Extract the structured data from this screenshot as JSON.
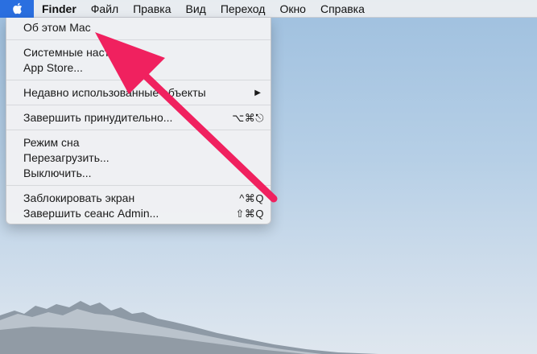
{
  "menubar": {
    "app_name": "Finder",
    "items": [
      "Файл",
      "Правка",
      "Вид",
      "Переход",
      "Окно",
      "Справка"
    ]
  },
  "apple_menu": {
    "about": "Об этом Mac",
    "system_prefs": "Системные настройки...",
    "app_store": "App Store...",
    "recent_items": "Недавно использованные объекты",
    "force_quit": "Завершить принудительно...",
    "force_quit_shortcut": "⌥⌘⎋",
    "sleep": "Режим сна",
    "restart": "Перезагрузить...",
    "shutdown": "Выключить...",
    "lock_screen": "Заблокировать экран",
    "lock_screen_shortcut": "^⌘Q",
    "log_out": "Завершить сеанс Admin...",
    "log_out_shortcut": "⇧⌘Q"
  },
  "colors": {
    "apple_highlight": "#2a6fe0",
    "annotation_arrow": "#f0215f"
  }
}
